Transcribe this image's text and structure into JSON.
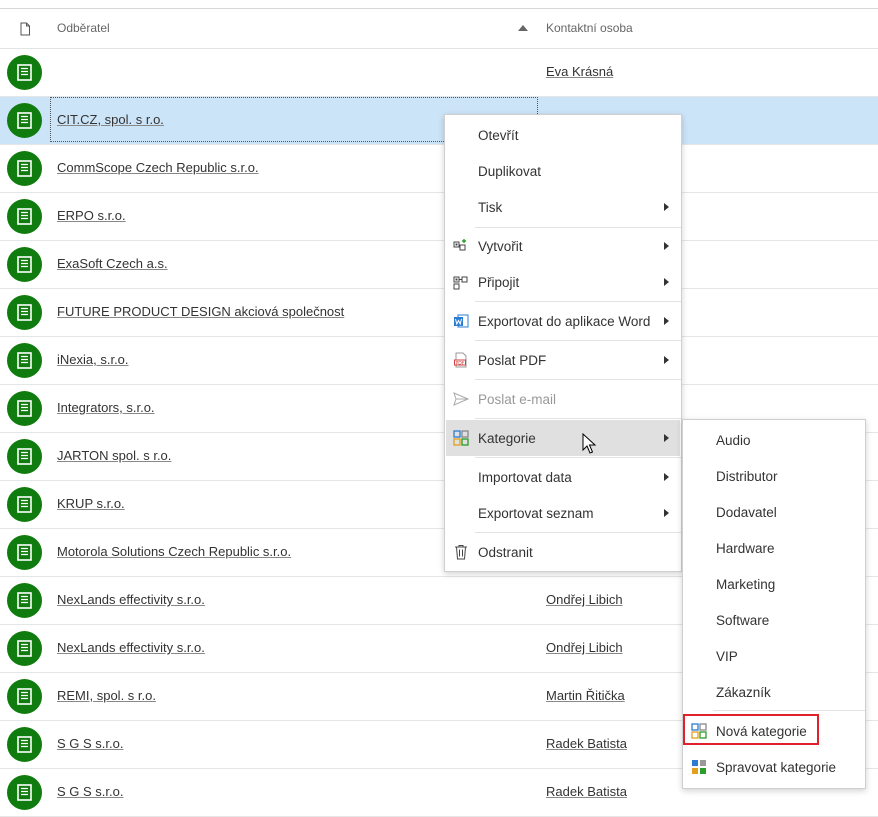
{
  "header": {
    "col_name": "Odběratel",
    "col_contact": "Kontaktní osoba"
  },
  "rows": [
    {
      "name": "",
      "contact": "Eva Krásná"
    },
    {
      "name": "CIT.CZ, spol. s r.o.",
      "contact": "",
      "selected": true
    },
    {
      "name": "CommScope Czech Republic s.r.o.",
      "contact": ""
    },
    {
      "name": "ERPO s.r.o.",
      "contact": ""
    },
    {
      "name": "ExaSoft Czech a.s.",
      "contact": ""
    },
    {
      "name": "FUTURE PRODUCT DESIGN akciová společnost",
      "contact": ""
    },
    {
      "name": "iNexia, s.r.o.",
      "contact": ""
    },
    {
      "name": "Integrators, s.r.o.",
      "contact": ""
    },
    {
      "name": "JARTON spol. s r.o.",
      "contact": ""
    },
    {
      "name": "KRUP s.r.o.",
      "contact": ""
    },
    {
      "name": "Motorola Solutions Czech Republic s.r.o.",
      "contact": ""
    },
    {
      "name": "NexLands effectivity s.r.o.",
      "contact": "Ondřej Libich"
    },
    {
      "name": "NexLands effectivity s.r.o.",
      "contact": "Ondřej Libich"
    },
    {
      "name": "REMI, spol. s r.o.",
      "contact": "Martin Řitička"
    },
    {
      "name": "S G S s.r.o.",
      "contact": "Radek Batista"
    },
    {
      "name": "S G S s.r.o.",
      "contact": "Radek Batista"
    }
  ],
  "context_menu": {
    "open": "Otevřít",
    "duplicate": "Duplikovat",
    "print": "Tisk",
    "create": "Vytvořit",
    "attach": "Připojit",
    "export_word": "Exportovat do aplikace Word",
    "send_pdf": "Poslat PDF",
    "send_email": "Poslat e-mail",
    "categories": "Kategorie",
    "import_data": "Importovat data",
    "export_list": "Exportovat seznam",
    "delete": "Odstranit"
  },
  "category_menu": {
    "items": [
      "Audio",
      "Distributor",
      "Dodavatel",
      "Hardware",
      "Marketing",
      "Software",
      "VIP",
      "Zákazník"
    ],
    "new_category": "Nová kategorie",
    "manage_categories": "Spravovat kategorie"
  },
  "colors": {
    "avatar_green": "#107c10",
    "selected_row": "#cce4f7",
    "highlight_red": "#e0202a"
  }
}
